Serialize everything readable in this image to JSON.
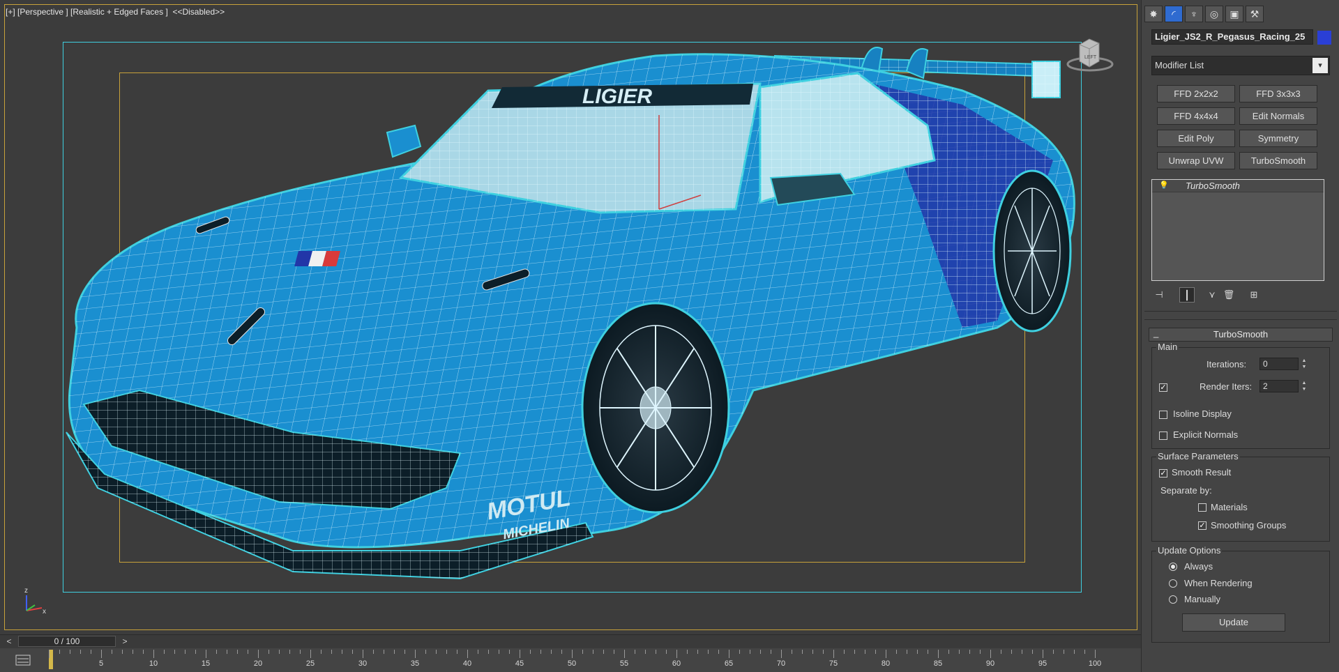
{
  "viewport": {
    "label": "[+] [Perspective ] [Realistic + Edged Faces ]  <<Disabled>>",
    "car_decals": {
      "windshield_text": "LIGIER",
      "sponsor_1": "MOTUL",
      "sponsor_2": "MICHELIN"
    },
    "viewcube_face": "LEFT",
    "axis": {
      "x": "x",
      "z": "z"
    }
  },
  "timeline": {
    "prev_label": "<",
    "next_label": ">",
    "frame_readout": "0 / 100",
    "ticks": [
      "5",
      "10",
      "15",
      "20",
      "25",
      "30",
      "35",
      "40",
      "45",
      "50",
      "55",
      "60",
      "65",
      "70",
      "75",
      "80",
      "85",
      "90",
      "95",
      "100"
    ]
  },
  "command_panel": {
    "tabs": [
      {
        "icon": "create-icon",
        "glyph": "✸"
      },
      {
        "icon": "modify-icon",
        "glyph": "◜"
      },
      {
        "icon": "hierarchy-icon",
        "glyph": "♆"
      },
      {
        "icon": "motion-icon",
        "glyph": "◎"
      },
      {
        "icon": "display-icon",
        "glyph": "▣"
      },
      {
        "icon": "utilities-icon",
        "glyph": "⚒"
      }
    ],
    "object_name": "Ligier_JS2_R_Pegasus_Racing_25",
    "object_color": "#2a3fd6",
    "modifier_list": "Modifier List",
    "modifier_buttons": [
      "FFD 2x2x2",
      "FFD 3x3x3",
      "FFD 4x4x4",
      "Edit Normals",
      "Edit Poly",
      "Symmetry",
      "Unwrap UVW",
      "TurboSmooth"
    ],
    "stack": [
      {
        "label": "TurboSmooth"
      }
    ]
  },
  "turbosmooth": {
    "title": "TurboSmooth",
    "collapse": "_",
    "main_group": "Main",
    "iterations_label": "Iterations:",
    "iterations_value": "0",
    "render_iters_label": "Render Iters:",
    "render_iters_value": "2",
    "render_iters_checked": true,
    "isoline_label": "Isoline Display",
    "isoline_checked": false,
    "explicit_normals_label": "Explicit Normals",
    "explicit_normals_checked": false,
    "surface_group": "Surface Parameters",
    "smooth_result_label": "Smooth Result",
    "smooth_result_checked": true,
    "separate_by_label": "Separate by:",
    "materials_label": "Materials",
    "materials_checked": false,
    "smoothing_groups_label": "Smoothing Groups",
    "smoothing_groups_checked": true,
    "update_group": "Update Options",
    "always_label": "Always",
    "when_rendering_label": "When Rendering",
    "manually_label": "Manually",
    "update_mode": "Always",
    "update_button": "Update"
  },
  "colors": {
    "wire": "#3fd0e0",
    "body": "#1a8fd0",
    "frame": "#c8a23a",
    "accent_blue": "#2f6bd0"
  }
}
